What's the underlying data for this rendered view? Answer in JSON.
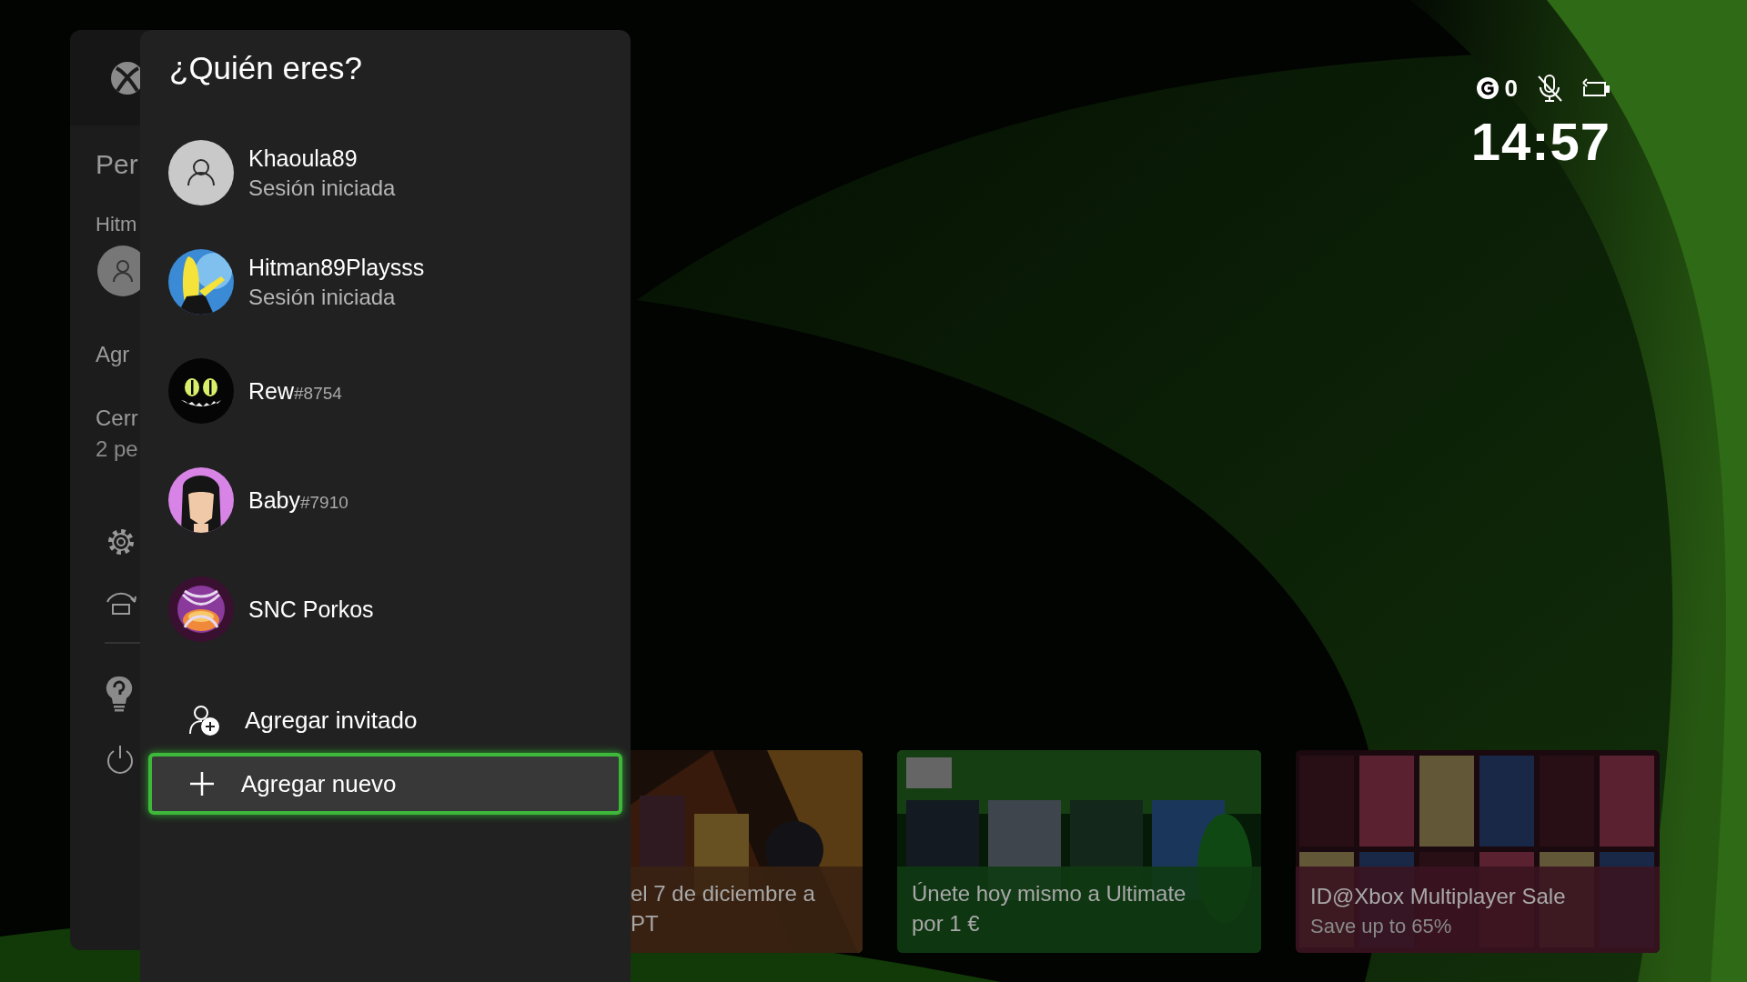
{
  "sidebar": {
    "heading": "Per",
    "account_label": "Hitm",
    "add_label": "Agr",
    "sign_out": {
      "label": "Cerr",
      "detail": "2 pe"
    }
  },
  "dialog": {
    "title": "¿Quién eres?",
    "profiles": [
      {
        "name": "Khaoula89",
        "status": "Sesión iniciada",
        "kind": "default"
      },
      {
        "name": "Hitman89Playsss",
        "status": "Sesión iniciada",
        "kind": "gamerpic"
      },
      {
        "name": "Rew",
        "tag": "#8754",
        "kind": "gamerpic"
      },
      {
        "name": "Baby",
        "tag": "#7910",
        "kind": "gamerpic"
      },
      {
        "name": "SNC Porkos",
        "kind": "gamerpic"
      }
    ],
    "actions": [
      {
        "kind": "guest",
        "label": "Agregar invitado",
        "selected": false
      },
      {
        "kind": "add",
        "label": "Agregar nuevo",
        "selected": true
      }
    ]
  },
  "status_bar": {
    "gold_count": "0",
    "mic_muted": true,
    "time": "14:57"
  },
  "tiles": [
    {
      "text": "el 7 de diciembre a PT"
    },
    {
      "text": "Únete hoy mismo a Ultimate por 1 €"
    },
    {
      "text": "ID@Xbox Multiplayer Sale",
      "subtitle": "Save up to 65%"
    }
  ]
}
